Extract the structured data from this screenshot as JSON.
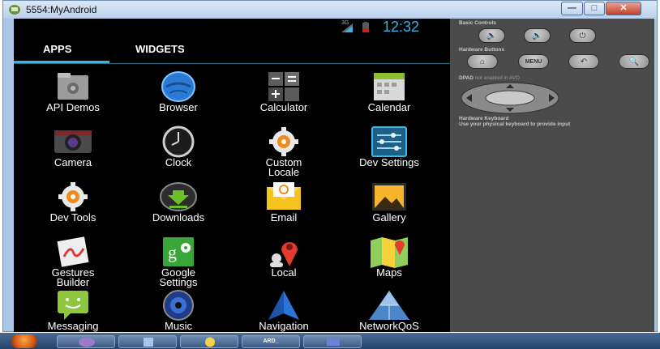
{
  "window": {
    "title": "5554:MyAndroid"
  },
  "status": {
    "network": "3G",
    "time": "12:32"
  },
  "tabs": {
    "apps": "APPS",
    "widgets": "WIDGETS",
    "selected": "APPS"
  },
  "apps": {
    "api_demos": "API Demos",
    "browser": "Browser",
    "calculator": "Calculator",
    "calendar": "Calendar",
    "camera": "Camera",
    "clock": "Clock",
    "custom_locale": "Custom\nLocale",
    "dev_settings": "Dev Settings",
    "dev_tools": "Dev Tools",
    "downloads": "Downloads",
    "email": "Email",
    "gallery": "Gallery",
    "gestures_builder": "Gestures\nBuilder",
    "google_settings": "Google\nSettings",
    "local": "Local",
    "maps": "Maps",
    "messaging": "Messaging",
    "music": "Music",
    "navigation": "Navigation",
    "networkqos": "NetworkQoS"
  },
  "controls": {
    "basic_header": "Basic Controls",
    "hardware_header": "Hardware Buttons",
    "menu_label": "MENU",
    "dpad_label": "DPAD",
    "dpad_status": "not enabled in AVD",
    "keyboard_header": "Hardware Keyboard",
    "keyboard_text": "Use your physical keyboard to provide input"
  },
  "taskbar": {
    "terminal_label": "ARD_"
  },
  "icons": {
    "volume_down": "volume-down-icon",
    "volume_up": "volume-up-icon",
    "power": "power-icon",
    "home": "home-icon",
    "back": "back-icon",
    "search": "search-icon"
  },
  "colors": {
    "accent": "#33b5e5",
    "panel": "#4b4b4b",
    "screen": "#000000"
  }
}
